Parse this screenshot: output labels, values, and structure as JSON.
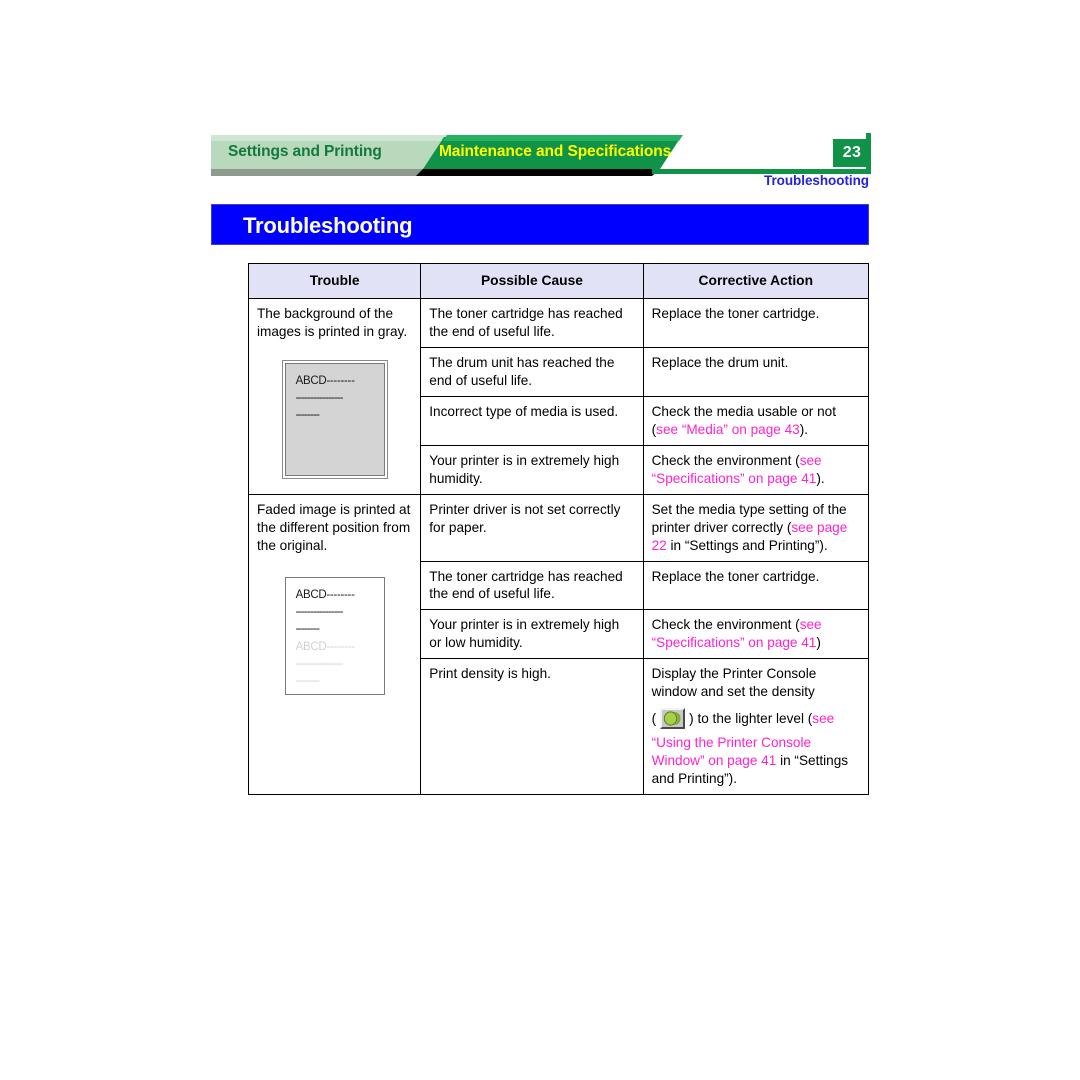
{
  "header": {
    "tab_settings": "Settings and Printing",
    "tab_maintenance": "Maintenance and Specifications",
    "page_number": "23",
    "subtitle": "Troubleshooting",
    "colors": {
      "tab_active_bg": "#109248",
      "tab_active_text": "#ffff00",
      "tab_inactive_text": "#117a3d",
      "page_badge_bg": "#109248",
      "subtitle_text": "#2222dd"
    }
  },
  "title_bar": {
    "title": "Troubleshooting",
    "bg_color": "#0000ff",
    "text_color": "#ffffff"
  },
  "table": {
    "headers": [
      "Trouble",
      "Possible Cause",
      "Corrective Action"
    ],
    "link_color": "#ff22cc",
    "groups": [
      {
        "trouble": "The background of the images is printed in gray.",
        "sample": {
          "style": "gray",
          "lines": [
            "ABCD--------",
            "----------------",
            "--------"
          ]
        },
        "rows": [
          {
            "cause": "The toner cartridge has reached the end of useful life.",
            "action_parts": [
              {
                "text": "Replace the toner cartridge.",
                "link": false
              }
            ]
          },
          {
            "cause": "The drum unit has reached the end of useful life.",
            "action_parts": [
              {
                "text": "Replace the drum unit.",
                "link": false
              }
            ]
          },
          {
            "cause": "Incorrect type of media is used.",
            "action_parts": [
              {
                "text": "Check the media usable or not (",
                "link": false
              },
              {
                "text": "see “Media” on page 43",
                "link": true
              },
              {
                "text": ").",
                "link": false
              }
            ]
          },
          {
            "cause": "Your printer is in extremely high humidity.",
            "action_parts": [
              {
                "text": "Check the environment (",
                "link": false
              },
              {
                "text": "see “Specifications” on page 41",
                "link": true
              },
              {
                "text": ").",
                "link": false
              }
            ]
          }
        ]
      },
      {
        "trouble": "Faded image is printed at the different position from the original.",
        "sample": {
          "style": "white",
          "lines": [
            "ABCD--------",
            "----------------",
            "--------"
          ],
          "faded_lines": [
            "ABCD--------",
            "----------------",
            "--------"
          ]
        },
        "rows": [
          {
            "cause": "Printer driver is not set correctly for paper.",
            "action_parts": [
              {
                "text": "Set the media type setting of the printer driver correctly (",
                "link": false
              },
              {
                "text": "see page 22",
                "link": true
              },
              {
                "text": " in “Settings and Printing”).",
                "link": false
              }
            ]
          },
          {
            "cause": "The toner cartridge has reached the end of useful life.",
            "action_parts": [
              {
                "text": "Replace the toner cartridge.",
                "link": false
              }
            ]
          },
          {
            "cause": "Your printer is in extremely high or low humidity.",
            "action_parts": [
              {
                "text": "Check the environment (",
                "link": false
              },
              {
                "text": "see “Specifications” on page 41",
                "link": true
              },
              {
                "text": ")",
                "link": false
              }
            ]
          },
          {
            "cause": "Print density is high.",
            "action_console": {
              "line1": "Display the Printer Console",
              "line2": "window and set the density",
              "before_icon": "(",
              "icon_name": "print-density-icon",
              "after_icon": ") to the lighter level (",
              "link_tail": "see",
              "link_block": "“Using the Printer Console Window” on page 41",
              "tail_plain": " in “Settings and Printing”)."
            }
          }
        ]
      }
    ]
  }
}
